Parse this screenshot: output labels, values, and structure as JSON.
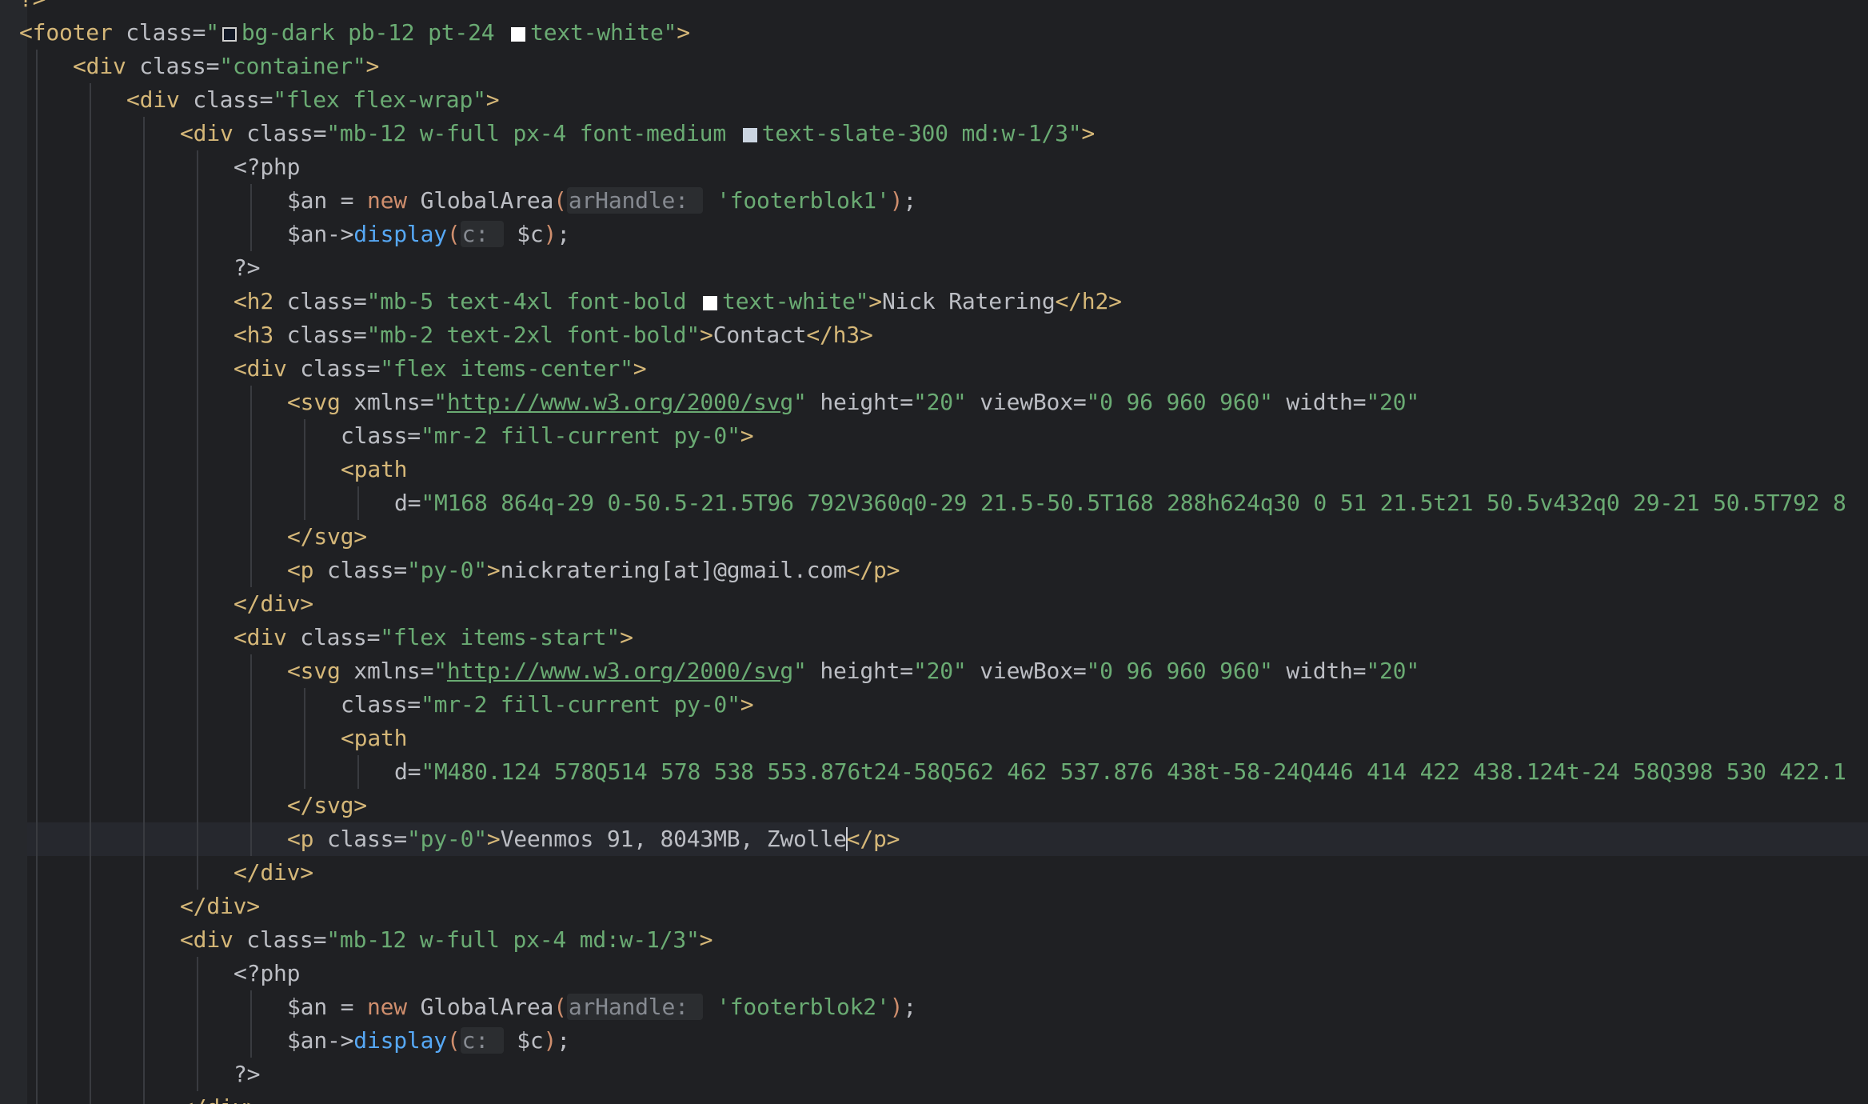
{
  "editor": {
    "background": "#1f2023",
    "cursor": {
      "line_index": 17,
      "after_text": "Veenmos 91, 8043MB, Zwolle"
    },
    "colors": {
      "tag": "#d5b778",
      "string": "#6aab73",
      "keyword": "#cf8e6d",
      "function": "#56a8f5",
      "inlay_hint": "#868a91",
      "plain": "#bcbec4"
    }
  },
  "lines": [
    {
      "indent": 0,
      "tokens": [
        {
          "t": "?>",
          "c": "tag"
        }
      ]
    },
    {
      "indent": 0,
      "tokens": [
        {
          "t": "<footer",
          "c": "tag"
        },
        {
          "t": " class=",
          "c": "attr"
        },
        {
          "t": "\"",
          "c": "str"
        },
        {
          "sw": "dark"
        },
        {
          "t": "bg-dark pb-12 pt-24 ",
          "c": "str"
        },
        {
          "sw": "white"
        },
        {
          "t": "text-white\"",
          "c": "str"
        },
        {
          "t": ">",
          "c": "tag"
        }
      ]
    },
    {
      "indent": 1,
      "tokens": [
        {
          "t": "<div",
          "c": "tag"
        },
        {
          "t": " class=",
          "c": "attr"
        },
        {
          "t": "\"container\"",
          "c": "str"
        },
        {
          "t": ">",
          "c": "tag"
        }
      ]
    },
    {
      "indent": 2,
      "tokens": [
        {
          "t": "<div",
          "c": "tag"
        },
        {
          "t": " class=",
          "c": "attr"
        },
        {
          "t": "\"flex flex-wrap\"",
          "c": "str"
        },
        {
          "t": ">",
          "c": "tag"
        }
      ]
    },
    {
      "indent": 3,
      "tokens": [
        {
          "t": "<div",
          "c": "tag"
        },
        {
          "t": " class=",
          "c": "attr"
        },
        {
          "t": "\"mb-12 w-full px-4 font-medium ",
          "c": "str"
        },
        {
          "sw": "slate"
        },
        {
          "t": "text-slate-300 md:w-1/3\"",
          "c": "str"
        },
        {
          "t": ">",
          "c": "tag"
        }
      ]
    },
    {
      "indent": 4,
      "tokens": [
        {
          "t": "<?php",
          "c": "plain"
        }
      ]
    },
    {
      "indent": 5,
      "tokens": [
        {
          "t": "$an = ",
          "c": "plain"
        },
        {
          "t": "new",
          "c": "kw"
        },
        {
          "t": " GlobalArea",
          "c": "plain"
        },
        {
          "t": "(",
          "c": "kw"
        },
        {
          "t": "arHandle: ",
          "c": "hint"
        },
        {
          "t": " 'footerblok1'",
          "c": "str"
        },
        {
          "t": ")",
          "c": "kw"
        },
        {
          "t": ";",
          "c": "plain"
        }
      ]
    },
    {
      "indent": 5,
      "tokens": [
        {
          "t": "$an->",
          "c": "plain"
        },
        {
          "t": "display",
          "c": "fn"
        },
        {
          "t": "(",
          "c": "kw"
        },
        {
          "t": "c: ",
          "c": "hint"
        },
        {
          "t": " $c",
          "c": "plain"
        },
        {
          "t": ")",
          "c": "kw"
        },
        {
          "t": ";",
          "c": "plain"
        }
      ]
    },
    {
      "indent": 4,
      "tokens": [
        {
          "t": "?>",
          "c": "plain"
        }
      ]
    },
    {
      "indent": 4,
      "tokens": [
        {
          "t": "<h2",
          "c": "tag"
        },
        {
          "t": " class=",
          "c": "attr"
        },
        {
          "t": "\"mb-5 text-4xl font-bold ",
          "c": "str"
        },
        {
          "sw": "white"
        },
        {
          "t": "text-white\"",
          "c": "str"
        },
        {
          "t": ">",
          "c": "tag"
        },
        {
          "t": "Nick Ratering",
          "c": "plain"
        },
        {
          "t": "</h2>",
          "c": "tag"
        }
      ]
    },
    {
      "indent": 4,
      "tokens": [
        {
          "t": "<h3",
          "c": "tag"
        },
        {
          "t": " class=",
          "c": "attr"
        },
        {
          "t": "\"mb-2 text-2xl font-bold\"",
          "c": "str"
        },
        {
          "t": ">",
          "c": "tag"
        },
        {
          "t": "Contact",
          "c": "plain"
        },
        {
          "t": "</h3>",
          "c": "tag"
        }
      ]
    },
    {
      "indent": 4,
      "tokens": [
        {
          "t": "<div",
          "c": "tag"
        },
        {
          "t": " class=",
          "c": "attr"
        },
        {
          "t": "\"flex items-center\"",
          "c": "str"
        },
        {
          "t": ">",
          "c": "tag"
        }
      ]
    },
    {
      "indent": 5,
      "tokens": [
        {
          "t": "<svg",
          "c": "tag"
        },
        {
          "t": " xmlns=",
          "c": "attr"
        },
        {
          "t": "\"",
          "c": "str"
        },
        {
          "t": "http://www.w3.org/2000/svg",
          "c": "link"
        },
        {
          "t": "\"",
          "c": "str"
        },
        {
          "t": " height=",
          "c": "attr"
        },
        {
          "t": "\"20\"",
          "c": "str"
        },
        {
          "t": " viewBox=",
          "c": "attr"
        },
        {
          "t": "\"0 96 960 960\"",
          "c": "str"
        },
        {
          "t": " width=",
          "c": "attr"
        },
        {
          "t": "\"20\"",
          "c": "str"
        }
      ]
    },
    {
      "indent": 6,
      "tokens": [
        {
          "t": "class=",
          "c": "attr"
        },
        {
          "t": "\"mr-2 fill-current py-0\"",
          "c": "str"
        },
        {
          "t": ">",
          "c": "tag"
        }
      ]
    },
    {
      "indent": 6,
      "tokens": [
        {
          "t": "<path",
          "c": "tag"
        }
      ]
    },
    {
      "indent": 7,
      "tokens": [
        {
          "t": "d=",
          "c": "attr"
        },
        {
          "t": "\"M168 864q-29 0-50.5-21.5T96 792V360q0-29 21.5-50.5T168 288h624q30 0 51 21.5t21 50.5v432q0 29-21 50.5T792 8",
          "c": "str"
        }
      ]
    },
    {
      "indent": 5,
      "tokens": [
        {
          "t": "</svg>",
          "c": "tag"
        }
      ]
    },
    {
      "indent": 5,
      "tokens": [
        {
          "t": "<p",
          "c": "tag"
        },
        {
          "t": " class=",
          "c": "attr"
        },
        {
          "t": "\"py-0\"",
          "c": "str"
        },
        {
          "t": ">",
          "c": "tag"
        },
        {
          "t": "nickratering[at]@gmail.com",
          "c": "plain"
        },
        {
          "t": "</p>",
          "c": "tag"
        }
      ]
    },
    {
      "indent": 4,
      "tokens": [
        {
          "t": "</div>",
          "c": "tag"
        }
      ]
    },
    {
      "indent": 4,
      "tokens": [
        {
          "t": "<div",
          "c": "tag"
        },
        {
          "t": " class=",
          "c": "attr"
        },
        {
          "t": "\"flex items-start\"",
          "c": "str"
        },
        {
          "t": ">",
          "c": "tag"
        }
      ]
    },
    {
      "indent": 5,
      "tokens": [
        {
          "t": "<svg",
          "c": "tag"
        },
        {
          "t": " xmlns=",
          "c": "attr"
        },
        {
          "t": "\"",
          "c": "str"
        },
        {
          "t": "http://www.w3.org/2000/svg",
          "c": "link"
        },
        {
          "t": "\"",
          "c": "str"
        },
        {
          "t": " height=",
          "c": "attr"
        },
        {
          "t": "\"20\"",
          "c": "str"
        },
        {
          "t": " viewBox=",
          "c": "attr"
        },
        {
          "t": "\"0 96 960 960\"",
          "c": "str"
        },
        {
          "t": " width=",
          "c": "attr"
        },
        {
          "t": "\"20\"",
          "c": "str"
        }
      ]
    },
    {
      "indent": 6,
      "tokens": [
        {
          "t": "class=",
          "c": "attr"
        },
        {
          "t": "\"mr-2 fill-current py-0\"",
          "c": "str"
        },
        {
          "t": ">",
          "c": "tag"
        }
      ]
    },
    {
      "indent": 6,
      "tokens": [
        {
          "t": "<path",
          "c": "tag"
        }
      ]
    },
    {
      "indent": 7,
      "tokens": [
        {
          "t": "d=",
          "c": "attr"
        },
        {
          "t": "\"M480.124 578Q514 578 538 553.876t24-58Q562 462 537.876 438t-58-24Q446 414 422 438.124t-24 58Q398 530 422.1",
          "c": "str"
        }
      ]
    },
    {
      "indent": 5,
      "tokens": [
        {
          "t": "</svg>",
          "c": "tag"
        }
      ]
    },
    {
      "indent": 5,
      "current": true,
      "tokens": [
        {
          "t": "<p",
          "c": "tag"
        },
        {
          "t": " class=",
          "c": "attr"
        },
        {
          "t": "\"py-0\"",
          "c": "str"
        },
        {
          "t": ">",
          "c": "tag"
        },
        {
          "t": "Veenmos 91, 8043MB, Zwolle",
          "c": "plain"
        },
        {
          "caret": true
        },
        {
          "t": "</p>",
          "c": "tag"
        }
      ]
    },
    {
      "indent": 4,
      "tokens": [
        {
          "t": "</div>",
          "c": "tag"
        }
      ]
    },
    {
      "indent": 3,
      "tokens": [
        {
          "t": "</div>",
          "c": "tag"
        }
      ]
    },
    {
      "indent": 3,
      "tokens": [
        {
          "t": "<div",
          "c": "tag"
        },
        {
          "t": " class=",
          "c": "attr"
        },
        {
          "t": "\"mb-12 w-full px-4 md:w-1/3\"",
          "c": "str"
        },
        {
          "t": ">",
          "c": "tag"
        }
      ]
    },
    {
      "indent": 4,
      "tokens": [
        {
          "t": "<?php",
          "c": "plain"
        }
      ]
    },
    {
      "indent": 5,
      "tokens": [
        {
          "t": "$an = ",
          "c": "plain"
        },
        {
          "t": "new",
          "c": "kw"
        },
        {
          "t": " GlobalArea",
          "c": "plain"
        },
        {
          "t": "(",
          "c": "kw"
        },
        {
          "t": "arHandle: ",
          "c": "hint"
        },
        {
          "t": " 'footerblok2'",
          "c": "str"
        },
        {
          "t": ")",
          "c": "kw"
        },
        {
          "t": ";",
          "c": "plain"
        }
      ]
    },
    {
      "indent": 5,
      "tokens": [
        {
          "t": "$an->",
          "c": "plain"
        },
        {
          "t": "display",
          "c": "fn"
        },
        {
          "t": "(",
          "c": "kw"
        },
        {
          "t": "c: ",
          "c": "hint"
        },
        {
          "t": " $c",
          "c": "plain"
        },
        {
          "t": ")",
          "c": "kw"
        },
        {
          "t": ";",
          "c": "plain"
        }
      ]
    },
    {
      "indent": 4,
      "tokens": [
        {
          "t": "?>",
          "c": "plain"
        }
      ]
    },
    {
      "indent": 3,
      "tokens": [
        {
          "t": "</div>",
          "c": "tag"
        }
      ]
    }
  ]
}
